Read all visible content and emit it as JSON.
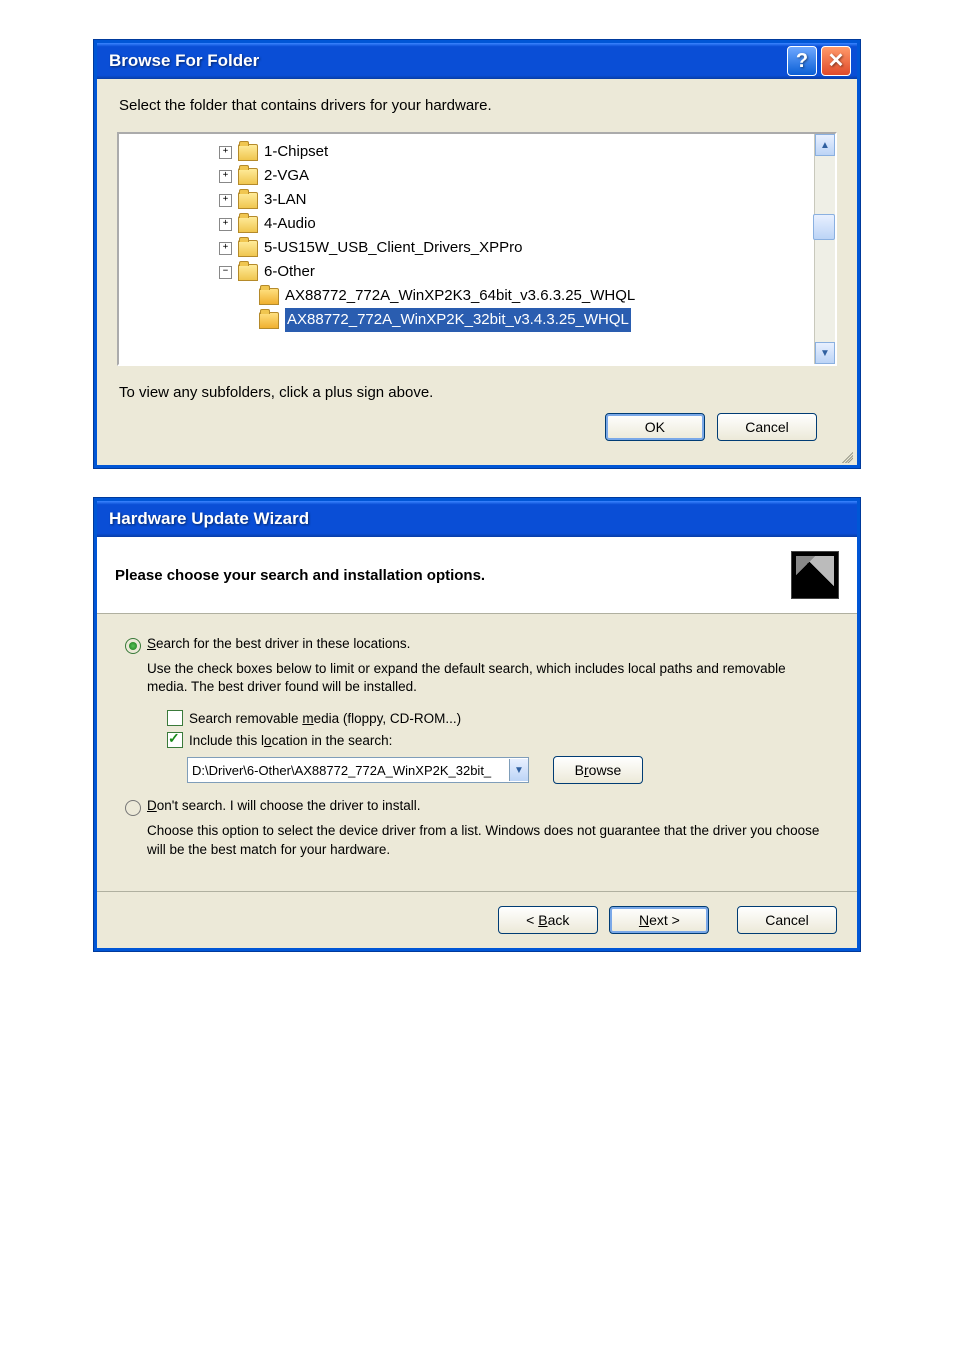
{
  "browse": {
    "title": "Browse For Folder",
    "instruction": "Select the folder that contains drivers for your hardware.",
    "tree": {
      "items": [
        {
          "label": "1-Chipset",
          "expand": "+"
        },
        {
          "label": "2-VGA",
          "expand": "+"
        },
        {
          "label": "3-LAN",
          "expand": "+"
        },
        {
          "label": "4-Audio",
          "expand": "+"
        },
        {
          "label": "5-US15W_USB_Client_Drivers_XPPro",
          "expand": "+"
        },
        {
          "label": "6-Other",
          "expand": "−"
        }
      ],
      "children": [
        {
          "label": "AX88772_772A_WinXP2K3_64bit_v3.6.3.25_WHQL",
          "selected": false
        },
        {
          "label": "AX88772_772A_WinXP2K_32bit_v3.4.3.25_WHQL",
          "selected": true
        }
      ]
    },
    "hint": "To view any subfolders, click a plus sign above.",
    "ok": "OK",
    "cancel": "Cancel"
  },
  "wizard": {
    "title": "Hardware Update Wizard",
    "heading": "Please choose your search and installation options.",
    "opt1": {
      "label_pre": "S",
      "label_rest": "earch for the best driver in these locations.",
      "desc": "Use the check boxes below to limit or expand the default search, which includes local paths and removable media. The best driver found will be installed.",
      "chk1_pre": "Search removable ",
      "chk1_u": "m",
      "chk1_post": "edia (floppy, CD-ROM...)",
      "chk2_pre": "Include this l",
      "chk2_u": "o",
      "chk2_post": "cation in the search:",
      "path": "D:\\Driver\\6-Other\\AX88772_772A_WinXP2K_32bit_",
      "browse_pre": "B",
      "browse_u": "r",
      "browse_post": "owse"
    },
    "opt2": {
      "label_u": "D",
      "label_rest": "on't search. I will choose the driver to install.",
      "desc": "Choose this option to select the device driver from a list.  Windows does not guarantee that the driver you choose will be the best match for your hardware."
    },
    "back_pre": "< ",
    "back_u": "B",
    "back_post": "ack",
    "next_u": "N",
    "next_post": "ext >",
    "cancel": "Cancel"
  }
}
